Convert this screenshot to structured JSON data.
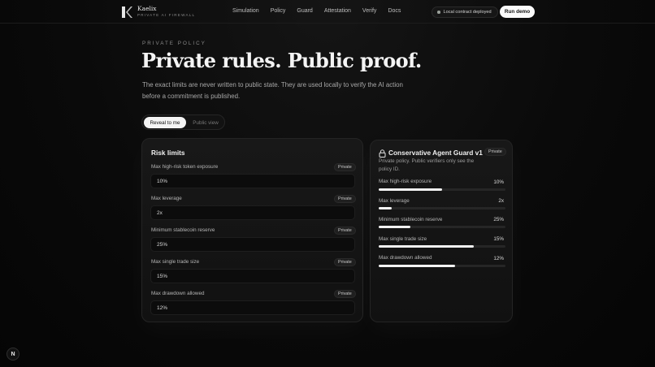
{
  "brand": {
    "name": "Kaelix",
    "tagline": "PRIVATE AI FIREWALL"
  },
  "nav": {
    "links": [
      "Simulation",
      "Policy",
      "Guard",
      "Attestation",
      "Verify",
      "Docs"
    ]
  },
  "status": {
    "deployed": "Local contract deployed"
  },
  "cta": {
    "run_demo": "Run demo"
  },
  "hero": {
    "eyebrow": "PRIVATE POLICY",
    "title": "Private rules. Public proof.",
    "description": "The exact limits are never written to public state. They are used locally to verify the AI action before a commitment is published."
  },
  "toggle": {
    "reveal": "Reveal to me",
    "public": "Public view"
  },
  "risk_limits": {
    "title": "Risk limits",
    "fields": [
      {
        "label": "Max high-risk token exposure",
        "badge": "Private",
        "value": "10%"
      },
      {
        "label": "Max leverage",
        "badge": "Private",
        "value": "2x"
      },
      {
        "label": "Minimum stablecoin reserve",
        "badge": "Private",
        "value": "25%"
      },
      {
        "label": "Max single trade size",
        "badge": "Private",
        "value": "15%"
      },
      {
        "label": "Max drawdown allowed",
        "badge": "Private",
        "value": "12%"
      }
    ]
  },
  "policy": {
    "title": "Conservative Agent Guard v1",
    "badge": "Private",
    "description": "Private policy. Public verifiers only see the policy ID.",
    "metrics": [
      {
        "label": "Max high-risk exposure",
        "value": "10%",
        "fill": 0.5
      },
      {
        "label": "Max leverage",
        "value": "2x",
        "fill": 0.1
      },
      {
        "label": "Minimum stablecoin reserve",
        "value": "25%",
        "fill": 0.25
      },
      {
        "label": "Max single trade size",
        "value": "15%",
        "fill": 0.75
      },
      {
        "label": "Max drawdown allowed",
        "value": "12%",
        "fill": 0.6
      }
    ]
  },
  "dev_badge": "N",
  "colors": {
    "background": "#0a0a0a",
    "accent": "#f4f4f4",
    "muted": "#a8a8a8"
  }
}
